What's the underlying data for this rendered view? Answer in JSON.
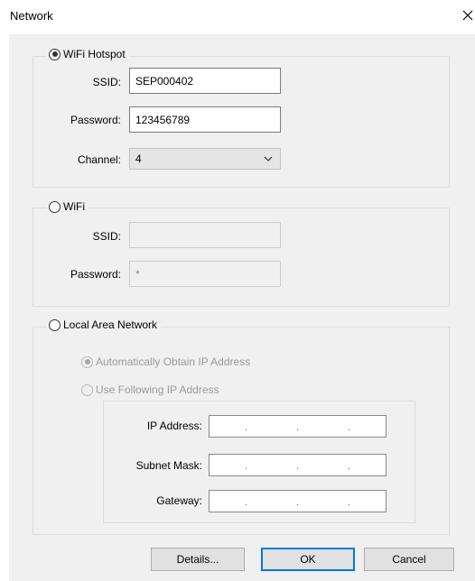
{
  "window": {
    "title": "Network",
    "close_icon": "close-icon"
  },
  "wifi_hotspot": {
    "label": "WiFi Hotspot",
    "selected": true,
    "ssid_label": "SSID:",
    "ssid_value": "SEP000402",
    "password_label": "Password:",
    "password_value": "123456789",
    "channel_label": "Channel:",
    "channel_value": "4"
  },
  "wifi": {
    "label": "WiFi",
    "selected": false,
    "ssid_label": "SSID:",
    "ssid_value": "",
    "password_label": "Password:",
    "password_value": "*"
  },
  "lan": {
    "label": "Local Area Network",
    "selected": false,
    "auto_ip_label": "Automatically Obtain IP Address",
    "manual_ip_label": "Use Following IP Address",
    "ip_address_label": "IP Address:",
    "subnet_mask_label": "Subnet Mask:",
    "gateway_label": "Gateway:",
    "ip_dots": ".   .   .",
    "dot": "."
  },
  "buttons": {
    "details": "Details...",
    "ok": "OK",
    "cancel": "Cancel"
  }
}
